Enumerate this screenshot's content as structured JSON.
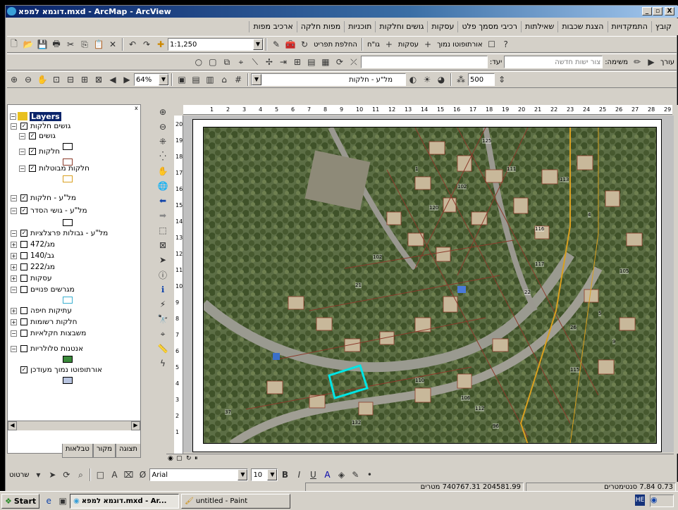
{
  "window": {
    "title": "דוגמא למפא.mxd - ArcMap - ArcView",
    "min": "_",
    "max": "▫",
    "close": "X"
  },
  "menu": [
    "קובץ",
    "התמקדויות",
    "הצגת שכבות",
    "שאילתות",
    "רכיבי מסמך פלט",
    "עסקות",
    "גושים וחלקות",
    "תוכניות",
    "מפות חלקה",
    "ארכיב מפות"
  ],
  "toolbar1": {
    "scale": "1:1,250",
    "swap_label": "החלפת תפריט",
    "gach_label": "גו\"ח",
    "deals_label": "עסקות",
    "ortho_label": "אורתופוטו נמוך"
  },
  "toolbar2": {
    "task_label": "משימה:",
    "task_value": "צור ישות חדשה",
    "target_label": "יעד:",
    "editor_label": "עורך"
  },
  "toolbar3": {
    "zoom": "64%",
    "layer_value": "מל\"ע - חלקות",
    "buffer": "500"
  },
  "ruler_h": [
    "1",
    "2",
    "3",
    "4",
    "5",
    "6",
    "7",
    "8",
    "9",
    "10",
    "11",
    "12",
    "13",
    "14",
    "15",
    "16",
    "17",
    "18",
    "19",
    "20",
    "21",
    "22",
    "23",
    "24",
    "25",
    "26",
    "27",
    "28",
    "29"
  ],
  "ruler_v": [
    "20",
    "19",
    "18",
    "17",
    "16",
    "15",
    "14",
    "13",
    "12",
    "11",
    "10",
    "9",
    "8",
    "7",
    "6",
    "5",
    "4",
    "3",
    "2",
    "1"
  ],
  "toc": {
    "root": "Layers",
    "items": [
      {
        "label": "גושים חלקות",
        "checked": "true"
      },
      {
        "label": "גושים",
        "checked": "true"
      },
      {
        "label": "חלקות",
        "checked": "true"
      },
      {
        "label": "חלקות מבוטלות",
        "checked": "true"
      },
      {
        "label": "מל\"ע - חלקות",
        "checked": "true"
      },
      {
        "label": "מל\"ע - גושי הסדר",
        "checked": "true"
      },
      {
        "label": "מל\"ע - גבולות פרצלציות",
        "checked": "true"
      },
      {
        "label": "מג/472",
        "checked": "false"
      },
      {
        "label": "גב/140",
        "checked": "false"
      },
      {
        "label": "מג/222",
        "checked": "false"
      },
      {
        "label": "עסקות",
        "checked": "false"
      },
      {
        "label": "מגרשים פנויים",
        "checked": "false"
      },
      {
        "label": "עתיקות חיפה",
        "checked": "false"
      },
      {
        "label": "חלקות רשומות",
        "checked": "false"
      },
      {
        "label": "משבצות חקלאיות",
        "checked": "false"
      },
      {
        "label": "אנטנות סלולריות",
        "checked": "false"
      },
      {
        "label": "אורתופוטו נמוך מעודכן",
        "checked": "true"
      }
    ],
    "tabs": [
      "תצוגה",
      "מקור",
      "טבלאות"
    ]
  },
  "map_labels": [
    "125",
    "111",
    "102",
    "113",
    "116",
    "120",
    "117",
    "21",
    "110",
    "106",
    "112",
    "132",
    "4",
    "22",
    "37",
    "26",
    "5",
    "9",
    "105",
    "115",
    "102",
    "1",
    "96"
  ],
  "drawing": {
    "menu": "שרטוט",
    "font": "Arial",
    "size": "10"
  },
  "status": {
    "coords": "204581.99 740767.31 מטרים",
    "page": "0.73 7.84 סנטימטרים"
  },
  "taskbar": {
    "start": "Start",
    "task1": "דוגמא למפא.mxd - Ar...",
    "task2": "untitled - Paint",
    "lang": "HE"
  },
  "colors": {
    "title_start": "#0a246a",
    "title_end": "#a6caf0",
    "selection": "#00e5e5",
    "parcel_line": "#8b3a2a",
    "block_line": "#d9a020"
  }
}
